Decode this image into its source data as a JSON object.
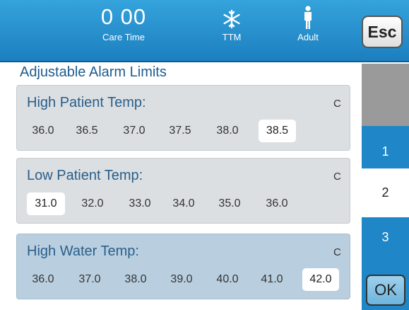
{
  "status_bar": {
    "care_time_value": "0 00",
    "care_time_label": "Care Time",
    "ttm_label": "TTM",
    "ttm_icon": "snowflake-icon",
    "patient_label": "Adult",
    "patient_icon": "adult-person-icon"
  },
  "esc_label": "Esc",
  "panel_title": "Adjustable Alarm Limits",
  "cards": [
    {
      "label": "High Patient Temp:",
      "unit": "C",
      "values": [
        "36.0",
        "36.5",
        "37.0",
        "37.5",
        "38.0",
        "38.5"
      ],
      "selected": "38.5"
    },
    {
      "label": "Low Patient Temp:",
      "unit": "C",
      "values": [
        "31.0",
        "32.0",
        "33.0",
        "34.0",
        "35.0",
        "36.0"
      ],
      "selected": "31.0"
    },
    {
      "label": "High Water Temp:",
      "unit": "C",
      "values": [
        "36.0",
        "37.0",
        "38.0",
        "39.0",
        "40.0",
        "41.0",
        "42.0"
      ],
      "selected": "42.0"
    }
  ],
  "side_tabs": [
    "1",
    "2",
    "3"
  ],
  "active_tab": "2",
  "ok_label": "OK",
  "colors": {
    "header_blue": "#1f86c7",
    "active_card": "#b9cfdf",
    "inactive_card": "#dcdfe1",
    "side_gray": "#9a9a9a"
  }
}
